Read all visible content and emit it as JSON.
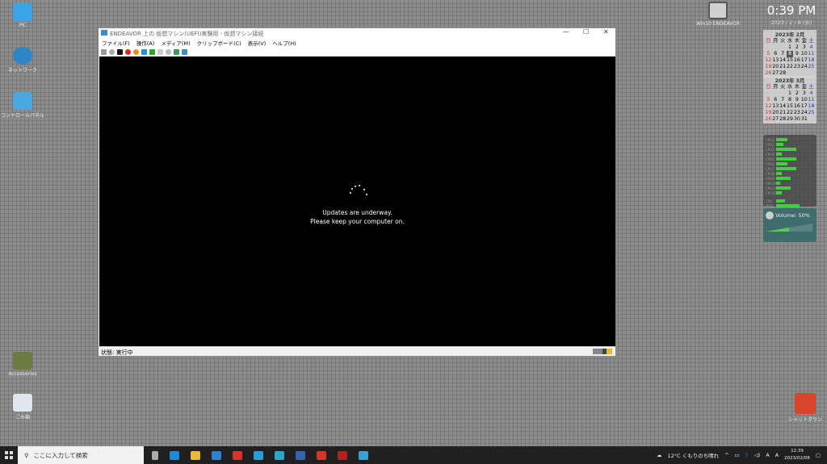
{
  "desktop_icons": [
    {
      "label": "PC",
      "color": "#3ba3e8"
    },
    {
      "label": "ネットワーク",
      "color": "#2e86c9"
    },
    {
      "label": "コントロールパネル",
      "color": "#4aa8e0"
    },
    {
      "label": "Accessories",
      "color": "#6a7a40"
    },
    {
      "label": "ごみ箱",
      "color": "#dfe6ee"
    },
    {
      "label": "Win10 ENDEAVOR",
      "color": "#d0d0d0"
    },
    {
      "label": "シャットダウン",
      "color": "#d9452b"
    }
  ],
  "window": {
    "title": "ENDEAVOR 上の 仮想マシン(UEFI)実験用 - 仮想マシン接続",
    "menu": [
      "ファイル(F)",
      "操作(A)",
      "メディア(M)",
      "クリップボード(C)",
      "表示(V)",
      "ヘルプ(H)"
    ],
    "screen_line1": "Updates are underway.",
    "screen_line2": "Please keep your computer on.",
    "status": "状態: 実行中"
  },
  "clock": {
    "time": "0:39 PM",
    "date": "2023 / 2 / 8 (水)"
  },
  "calendars": [
    {
      "title": "2023年 2月",
      "weekdays": [
        "日",
        "月",
        "火",
        "水",
        "木",
        "金",
        "土"
      ],
      "days": [
        "",
        "",
        "",
        "1",
        "2",
        "3",
        "4",
        "5",
        "6",
        "7",
        "8",
        "9",
        "10",
        "11",
        "12",
        "13",
        "14",
        "15",
        "16",
        "17",
        "18",
        "19",
        "20",
        "21",
        "22",
        "23",
        "24",
        "25",
        "26",
        "27",
        "28"
      ],
      "today": "8"
    },
    {
      "title": "2023年 3月",
      "weekdays": [
        "日",
        "月",
        "火",
        "水",
        "木",
        "金",
        "土"
      ],
      "days": [
        "",
        "",
        "",
        "1",
        "2",
        "3",
        "4",
        "5",
        "6",
        "7",
        "8",
        "9",
        "10",
        "11",
        "12",
        "13",
        "14",
        "15",
        "16",
        "17",
        "18",
        "19",
        "20",
        "21",
        "22",
        "23",
        "24",
        "25",
        "26",
        "27",
        "28",
        "29",
        "30",
        "31"
      ]
    }
  ],
  "cpu": {
    "labels": [
      "CPU1",
      "CPU2",
      "CPU3",
      "CPU4",
      "CPU5",
      "CPU6",
      "CPU7",
      "CPU8",
      "CPU9",
      "CPU10",
      "CPU11",
      "CPU12",
      "CPU",
      "MEM"
    ],
    "percent": [
      30,
      20,
      55,
      15,
      55,
      30,
      55,
      15,
      40,
      10,
      40,
      15,
      25,
      65
    ]
  },
  "volume": {
    "label": "Volume: 50%",
    "level": 50
  },
  "taskbar": {
    "search_placeholder": "ここに入力して検索",
    "apps": [
      "#aaa",
      "#1f8ad6",
      "#e8b93a",
      "#2f7fd4",
      "#d9322b",
      "#2a9fd6",
      "#2aa6c8",
      "#3561b8",
      "#d9322b",
      "#b02020",
      "#3aa0d0"
    ],
    "weather": "12°C くもりのち晴れ",
    "time": "12:39",
    "date": "2023/02/08"
  }
}
